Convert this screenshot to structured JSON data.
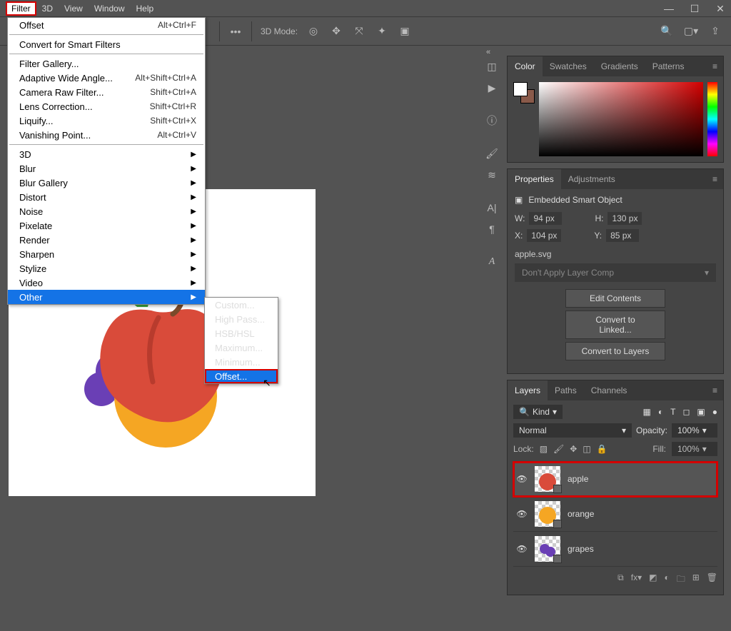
{
  "menubar": [
    "Filter",
    "3D",
    "View",
    "Window",
    "Help"
  ],
  "filter_menu": {
    "top": {
      "label": "Offset",
      "shortcut": "Alt+Ctrl+F"
    },
    "convert": "Convert for Smart Filters",
    "group2": [
      {
        "label": "Filter Gallery..."
      },
      {
        "label": "Adaptive Wide Angle...",
        "shortcut": "Alt+Shift+Ctrl+A"
      },
      {
        "label": "Camera Raw Filter...",
        "shortcut": "Shift+Ctrl+A"
      },
      {
        "label": "Lens Correction...",
        "shortcut": "Shift+Ctrl+R"
      },
      {
        "label": "Liquify...",
        "shortcut": "Shift+Ctrl+X"
      },
      {
        "label": "Vanishing Point...",
        "shortcut": "Alt+Ctrl+V"
      }
    ],
    "group3": [
      "3D",
      "Blur",
      "Blur Gallery",
      "Distort",
      "Noise",
      "Pixelate",
      "Render",
      "Sharpen",
      "Stylize",
      "Video",
      "Other"
    ]
  },
  "submenu": [
    "Custom...",
    "High Pass...",
    "HSB/HSL",
    "Maximum...",
    "Minimum...",
    "Offset..."
  ],
  "toolbar_3d_label": "3D Mode:",
  "color_panel": {
    "tabs": [
      "Color",
      "Swatches",
      "Gradients",
      "Patterns"
    ]
  },
  "properties_panel": {
    "tabs": [
      "Properties",
      "Adjustments"
    ],
    "type_label": "Embedded Smart Object",
    "W_label": "W:",
    "W": "94 px",
    "H_label": "H:",
    "H": "130 px",
    "X_label": "X:",
    "X": "104 px",
    "Y_label": "Y:",
    "Y": "85 px",
    "filename": "apple.svg",
    "layercomp": "Don't Apply Layer Comp",
    "buttons": [
      "Edit Contents",
      "Convert to Linked...",
      "Convert to Layers"
    ]
  },
  "layers_panel": {
    "tabs": [
      "Layers",
      "Paths",
      "Channels"
    ],
    "kind_label": "Kind",
    "blend": "Normal",
    "opacity_label": "Opacity:",
    "opacity": "100%",
    "lock_label": "Lock:",
    "fill_label": "Fill:",
    "fill": "100%",
    "layers": [
      {
        "name": "apple",
        "selected": true
      },
      {
        "name": "orange",
        "selected": false
      },
      {
        "name": "grapes",
        "selected": false
      }
    ]
  }
}
